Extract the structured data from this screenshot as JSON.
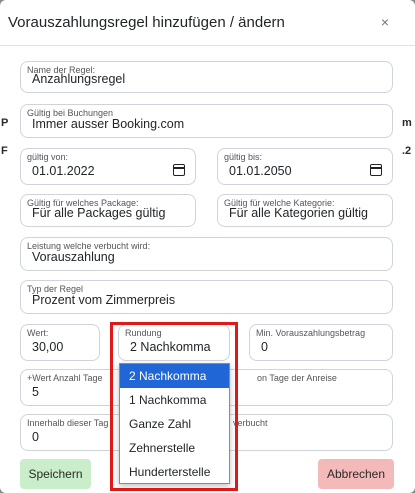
{
  "background": {
    "left_letters": [
      "P",
      "F"
    ],
    "right_letters": [
      "m",
      ".2"
    ]
  },
  "modal": {
    "title": "Vorauszahlungsregel hinzufügen / ändern",
    "close_symbol": "×"
  },
  "form": {
    "name": {
      "label": "Name der Regel:",
      "value": "Anzahlungsregel"
    },
    "valid_bookings": {
      "label": "Gültig bei Buchungen",
      "value": "Immer ausser Booking.com"
    },
    "valid_from": {
      "label": "gültig von:",
      "value": "01.01.2022"
    },
    "valid_to": {
      "label": "gültig bis:",
      "value": "01.01.2050"
    },
    "package": {
      "label": "Gültig für welches Package:",
      "value": "Für alle Packages gültig"
    },
    "category": {
      "label": "Gültig für welche Kategorie:",
      "value": "Für alle Kategorien gültig"
    },
    "service": {
      "label": "Leistung welche verbucht wird:",
      "value": "Vorauszahlung"
    },
    "rule_type": {
      "label": "Typ der Regel",
      "value": "Prozent vom Zimmerpreis"
    },
    "value": {
      "label": "Wert:",
      "value": "30,00"
    },
    "rounding": {
      "label": "Rundung",
      "value": "2 Nachkomma"
    },
    "min_prepay": {
      "label": "Min. Vorauszahlungsbetrag",
      "value": "0"
    },
    "plus_value": {
      "label": "+Wert Anzahl Tage",
      "label_right": "on Tage der Anreise",
      "value": "5"
    },
    "within": {
      "label": "Innerhalb dieser Tag",
      "label_right": "verbucht",
      "value": "0"
    }
  },
  "rounding_options": [
    {
      "label": "2 Nachkomma",
      "selected": true
    },
    {
      "label": "1 Nachkomma",
      "selected": false
    },
    {
      "label": "Ganze Zahl",
      "selected": false
    },
    {
      "label": "Zehnerstelle",
      "selected": false
    },
    {
      "label": "Hunderterstelle",
      "selected": false
    }
  ],
  "buttons": {
    "save": "Speichern",
    "cancel": "Abbrechen"
  },
  "colors": {
    "save_bg": "#c9eec9",
    "cancel_bg": "#f4b9b9",
    "highlight": "#e01818",
    "selected_option": "#2166d6"
  }
}
